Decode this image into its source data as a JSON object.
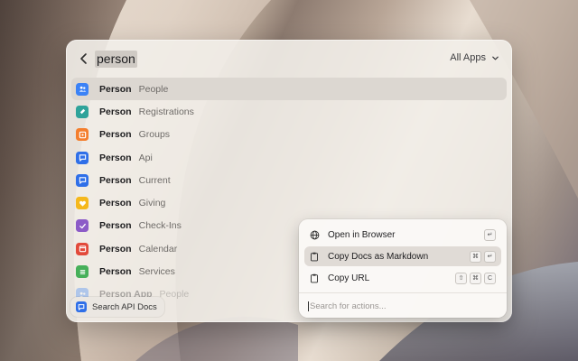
{
  "search": {
    "query": "person",
    "filter_label": "All Apps"
  },
  "results": [
    {
      "title": "Person",
      "subtitle": "People",
      "icon": "people-icon",
      "color": "#3b82f6"
    },
    {
      "title": "Person",
      "subtitle": "Registrations",
      "icon": "registrations-icon",
      "color": "#2fa39a"
    },
    {
      "title": "Person",
      "subtitle": "Groups",
      "icon": "groups-icon",
      "color": "#f47e2d"
    },
    {
      "title": "Person",
      "subtitle": "Api",
      "icon": "api-icon",
      "color": "#2f6fe8"
    },
    {
      "title": "Person",
      "subtitle": "Current",
      "icon": "current-icon",
      "color": "#2f6fe8"
    },
    {
      "title": "Person",
      "subtitle": "Giving",
      "icon": "giving-icon",
      "color": "#f5b81c"
    },
    {
      "title": "Person",
      "subtitle": "Check-Ins",
      "icon": "check-ins-icon",
      "color": "#8c5bc7"
    },
    {
      "title": "Person",
      "subtitle": "Calendar",
      "icon": "calendar-icon",
      "color": "#e24a3b"
    },
    {
      "title": "Person",
      "subtitle": "Services",
      "icon": "services-icon",
      "color": "#47b05a"
    },
    {
      "title": "Person App",
      "subtitle": "People",
      "icon": "people-icon",
      "color": "#3b82f6"
    }
  ],
  "bottom_tag": {
    "label": "Search API Docs",
    "icon": "api-docs-icon"
  },
  "actions": [
    {
      "label": "Open in Browser",
      "icon": "globe-icon",
      "keys": [
        "↵"
      ]
    },
    {
      "label": "Copy Docs as Markdown",
      "icon": "clipboard-icon",
      "keys": [
        "⌘",
        "↵"
      ]
    },
    {
      "label": "Copy URL",
      "icon": "clipboard-icon",
      "keys": [
        "⇧",
        "⌘",
        "C"
      ]
    }
  ],
  "action_search": {
    "placeholder": "Search for actions..."
  }
}
